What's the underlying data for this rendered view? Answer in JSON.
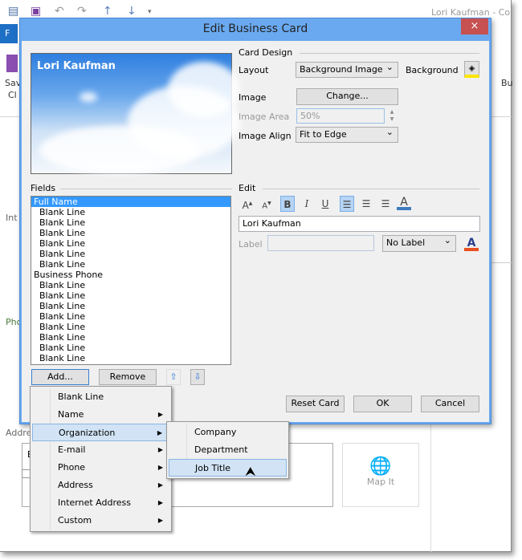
{
  "app": {
    "title": "Lori Kaufman - Co",
    "file_tab": "F",
    "ribbon_save": "Sav",
    "ribbon_save2": "Cl",
    "ribbon_right": "Bu",
    "side_labels": [
      "Int",
      "Pho",
      "Addre"
    ],
    "address_value": "B",
    "map_it": "Map It"
  },
  "dialog": {
    "title": "Edit Business Card",
    "close": "×",
    "card": {
      "name": "Lori Kaufman"
    },
    "card_design": {
      "heading": "Card Design",
      "layout_label": "Layout",
      "layout_value": "Background Image",
      "background_label": "Background",
      "image_label": "Image",
      "change_button": "Change...",
      "image_area_label": "Image Area",
      "image_area_value": "50%",
      "image_align_label": "Image Align",
      "image_align_value": "Fit to Edge"
    },
    "fields": {
      "heading": "Fields",
      "items": [
        {
          "text": "Full Name",
          "indent": false,
          "selected": true
        },
        {
          "text": "Blank Line",
          "indent": true
        },
        {
          "text": "Blank Line",
          "indent": true
        },
        {
          "text": "Blank Line",
          "indent": true
        },
        {
          "text": "Blank Line",
          "indent": true
        },
        {
          "text": "Blank Line",
          "indent": true
        },
        {
          "text": "Blank Line",
          "indent": true
        },
        {
          "text": "Business Phone",
          "indent": false
        },
        {
          "text": "Blank Line",
          "indent": true
        },
        {
          "text": "Blank Line",
          "indent": true
        },
        {
          "text": "Blank Line",
          "indent": true
        },
        {
          "text": "Blank Line",
          "indent": true
        },
        {
          "text": "Blank Line",
          "indent": true
        },
        {
          "text": "Blank Line",
          "indent": true
        },
        {
          "text": "Blank Line",
          "indent": true
        },
        {
          "text": "Blank Line",
          "indent": true
        }
      ],
      "add_button": "Add...",
      "remove_button": "Remove"
    },
    "edit": {
      "heading": "Edit",
      "text_value": "Lori Kaufman",
      "label_label": "Label",
      "label_value": "",
      "label_position": "No Label",
      "bold": "B",
      "italic": "I",
      "underline": "U",
      "font_color": "A"
    },
    "buttons": {
      "reset": "Reset Card",
      "ok": "OK",
      "cancel": "Cancel"
    }
  },
  "add_menu": {
    "items": [
      {
        "label": "Blank Line",
        "sub": false
      },
      {
        "label": "Name",
        "sub": true
      },
      {
        "label": "Organization",
        "sub": true,
        "highlighted": true
      },
      {
        "label": "E-mail",
        "sub": true
      },
      {
        "label": "Phone",
        "sub": true
      },
      {
        "label": "Address",
        "sub": true
      },
      {
        "label": "Internet Address",
        "sub": true
      },
      {
        "label": "Custom",
        "sub": true
      }
    ]
  },
  "org_submenu": {
    "items": [
      {
        "label": "Company"
      },
      {
        "label": "Department"
      },
      {
        "label": "Job Title",
        "highlighted": true
      }
    ]
  },
  "colors": {
    "accent": "#6aa9f0",
    "selection": "#3399ff",
    "close": "#c75050",
    "menu_highlight": "#d1e3f5"
  }
}
